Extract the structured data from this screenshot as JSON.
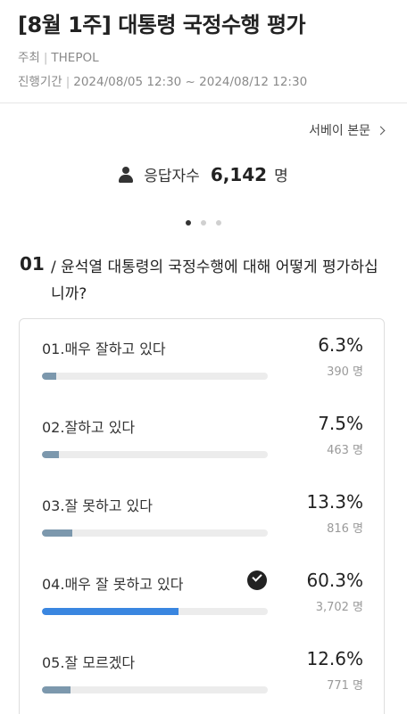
{
  "header": {
    "title": "[8월 1주] 대통령 국정수행 평가",
    "host_label": "주최",
    "host_value": "THEPOL",
    "period_label": "진행기간",
    "period_value": "2024/08/05 12:30 ~ 2024/08/12 12:30",
    "separator": "|"
  },
  "body_link": {
    "label": "서베이 본문"
  },
  "respondents": {
    "label": "응답자수",
    "count": "6,142",
    "unit": "명"
  },
  "carousel": {
    "pages": 3,
    "active": 1
  },
  "question": {
    "number": "01",
    "prefix": "/",
    "text": "윤석열 대통령의 국정수행에 대해 어떻게 평가하십니까?"
  },
  "options": [
    {
      "label": "01.매우 잘하고 있다",
      "percent_text": "6.3%",
      "count_text": "390 명",
      "percent": 6.3,
      "selected": false
    },
    {
      "label": "02.잘하고 있다",
      "percent_text": "7.5%",
      "count_text": "463 명",
      "percent": 7.5,
      "selected": false
    },
    {
      "label": "03.잘 못하고 있다",
      "percent_text": "13.3%",
      "count_text": "816 명",
      "percent": 13.3,
      "selected": false
    },
    {
      "label": "04.매우 잘 못하고 있다",
      "percent_text": "60.3%",
      "count_text": "3,702 명",
      "percent": 60.3,
      "selected": true
    },
    {
      "label": "05.잘 모르겠다",
      "percent_text": "12.6%",
      "count_text": "771 명",
      "percent": 12.6,
      "selected": false
    }
  ],
  "colors": {
    "bar_default": "#7c98ad",
    "bar_selected": "#3a86e0",
    "track": "#ececec",
    "check": "#222222"
  },
  "icons": {
    "respondents": "person-icon",
    "body_link": "chevron-right-icon",
    "selected": "check-circle-icon"
  }
}
